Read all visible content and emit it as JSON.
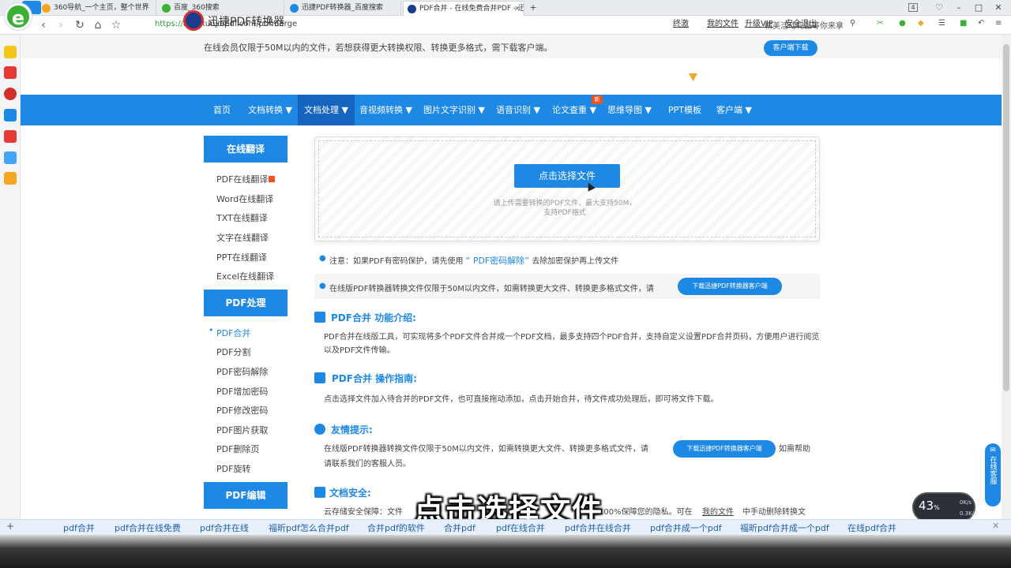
{
  "browser": {
    "tabs": [
      {
        "title": "360导航_一个主页，整个世界"
      },
      {
        "title": "百度_360搜索"
      },
      {
        "title": "迅捷PDF转换器_百度搜索"
      },
      {
        "title": "PDF合并 - 在线免费合并PDF - 迅"
      }
    ],
    "tab_count": "4",
    "url_scheme": "https://",
    "url_rest": "app.xunjiepdf.com/pdfmerge",
    "ad_text": "精美活动礼品等你来拿"
  },
  "notice": {
    "text": "在线会员仅限于50M以内的文件，若想获得更大转换权限、转换更多格式，需下载客户端。",
    "download_btn": "客户端下载"
  },
  "header": {
    "logo_text": "迅捷PDF转换器",
    "links": [
      "终激",
      "我的文件",
      "升级VIP",
      "安全退出"
    ]
  },
  "nav": {
    "items": [
      "首页",
      "文档转换",
      "文档处理",
      "音视频转换",
      "图片文字识别",
      "语音识别",
      "论文查重",
      "思维导图",
      "PPT模板",
      "客户端"
    ],
    "new_badge": "新"
  },
  "side": {
    "translate_head": "在线翻译",
    "translate_items": [
      "PDF在线翻译",
      "Word在线翻译",
      "TXT在线翻译",
      "文字在线翻译",
      "PPT在线翻译",
      "Excel在线翻译"
    ],
    "pdf_head": "PDF处理",
    "pdf_items": [
      "PDF合并",
      "PDF分割",
      "PDF密码解除",
      "PDF增加密码",
      "PDF修改密码",
      "PDF图片获取",
      "PDF删除页",
      "PDF旋转"
    ],
    "edit_head": "PDF编辑"
  },
  "upload": {
    "button": "点击选择文件",
    "hint1": "请上传需要转换的PDF文件，最大支持50M，",
    "hint2": "支持PDF格式"
  },
  "notes": {
    "note1_a": "注意：如果PDF有密码保护，请先使用",
    "note1_link": "“ PDF密码解除”",
    "note1_b": "去除加密保护再上传文件",
    "note2": "在线版PDF转换器转换文件仅限于50M以内文件，如需转换更大文件、转换更多格式文件，请",
    "note2_btn": "下载迅捷PDF转换器客户端"
  },
  "sections": {
    "intro_title": "PDF合并 功能介绍:",
    "intro_text": "PDF合并在线版工具，可实现将多个PDF文件合并成一个PDF文档，最多支持四个PDF合并，支持自定义设置PDF合并页码，方便用户进行阅览以及PDF文件传输。",
    "guide_title": "PDF合并 操作指南:",
    "guide_text": "点击选择文件加入待合并的PDF文件，也可直接拖动添加，点击开始合并，待文件成功处理后，即可将文件下载。",
    "tip_title": "友情提示:",
    "tip_text_a": "在线版PDF转换器转换文件仅限于50M以内文件，如需转换更大文件、转换更多格式文件，请",
    "tip_btn": "下载迅捷PDF转换器客户端",
    "tip_text_b": "如需帮助",
    "tip_text_c": "请联系我们的客服人员。",
    "safe_title": "文档安全:",
    "safe_text_a": "云存储安全保障：文件",
    "safe_text_b": "100%保障您的隐私。可在",
    "safe_link": "我的文件",
    "safe_text_c": "中手动删除转换文"
  },
  "float_service": "在线客服",
  "speed": {
    "value": "43",
    "unit": "%",
    "up": "0K/s",
    "down": "0.3K/s"
  },
  "subtitle": "点击选择文件",
  "keywords": [
    "pdf合并",
    "pdf合并在线免费",
    "pdf合并在线",
    "福昕pdf怎么合并pdf",
    "合并pdf的软件",
    "合并pdf",
    "pdf在线合并",
    "pdf合并在线合并",
    "pdf合并成一个pdf",
    "福昕pdf合并成一个pdf",
    "在线pdf合并"
  ]
}
